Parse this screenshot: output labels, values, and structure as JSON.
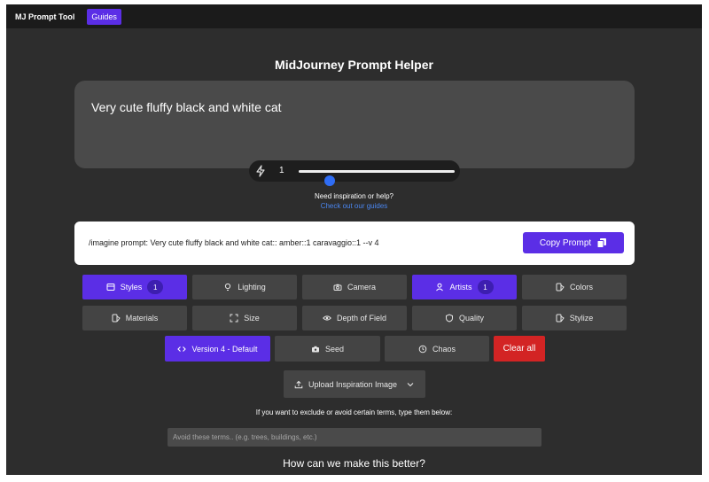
{
  "topbar": {
    "brand": "MJ Prompt Tool",
    "guides_label": "Guides"
  },
  "page": {
    "title": "MidJourney Prompt Helper"
  },
  "prompt": {
    "text": "Very cute fluffy black and white cat"
  },
  "slider": {
    "value": "1",
    "level_fraction": 0.2,
    "icon": "bolt-icon"
  },
  "help": {
    "question": "Need inspiration or help?",
    "link": "Check out our guides"
  },
  "output": {
    "text": "/imagine prompt: Very cute fluffy black and white cat:: amber::1 caravaggio::1 --v 4",
    "copy_label": "Copy Prompt"
  },
  "options": {
    "styles": {
      "label": "Styles",
      "count": "1"
    },
    "lighting": {
      "label": "Lighting"
    },
    "camera": {
      "label": "Camera"
    },
    "artists": {
      "label": "Artists",
      "count": "1"
    },
    "colors": {
      "label": "Colors"
    },
    "materials": {
      "label": "Materials"
    },
    "size": {
      "label": "Size"
    },
    "depth_of_field": {
      "label": "Depth of Field"
    },
    "quality": {
      "label": "Quality"
    },
    "stylize": {
      "label": "Stylize"
    },
    "version": {
      "label": "Version 4 - Default"
    },
    "seed": {
      "label": "Seed"
    },
    "chaos": {
      "label": "Chaos"
    },
    "clear": {
      "label": "Clear all"
    }
  },
  "upload": {
    "label": "Upload Inspiration Image"
  },
  "exclude": {
    "label": "If you want to exclude or avoid certain terms, type them below:",
    "placeholder": "Avoid these terms.. (e.g. trees, buildings, etc.)"
  },
  "feedback": {
    "title": "How can we make this better?"
  },
  "colors": {
    "accent": "#5b2ee6",
    "danger": "#d32424",
    "background": "#2d2d2d",
    "link": "#4a86f0"
  }
}
